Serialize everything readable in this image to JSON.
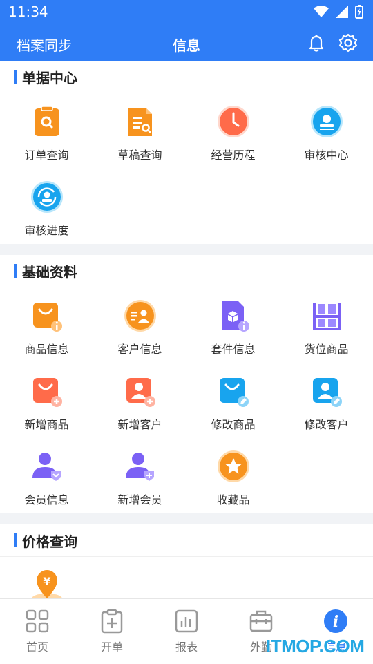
{
  "status_bar": {
    "time": "11:34"
  },
  "header": {
    "left_label": "档案同步",
    "title": "信息"
  },
  "sections": [
    {
      "title": "单据中心",
      "items": [
        {
          "label": "订单查询",
          "icon": "order-search-icon"
        },
        {
          "label": "草稿查询",
          "icon": "draft-search-icon"
        },
        {
          "label": "经营历程",
          "icon": "clock-icon"
        },
        {
          "label": "审核中心",
          "icon": "review-center-icon"
        },
        {
          "label": "审核进度",
          "icon": "review-progress-icon"
        }
      ]
    },
    {
      "title": "基础资料",
      "items": [
        {
          "label": "商品信息",
          "icon": "product-info-icon"
        },
        {
          "label": "客户信息",
          "icon": "customer-info-icon"
        },
        {
          "label": "套件信息",
          "icon": "kit-info-icon"
        },
        {
          "label": "货位商品",
          "icon": "shelf-icon"
        },
        {
          "label": "新增商品",
          "icon": "add-product-icon"
        },
        {
          "label": "新增客户",
          "icon": "add-customer-icon"
        },
        {
          "label": "修改商品",
          "icon": "edit-product-icon"
        },
        {
          "label": "修改客户",
          "icon": "edit-customer-icon"
        },
        {
          "label": "会员信息",
          "icon": "member-info-icon"
        },
        {
          "label": "新增会员",
          "icon": "add-member-icon"
        },
        {
          "label": "收藏品",
          "icon": "star-icon"
        }
      ]
    },
    {
      "title": "价格查询",
      "items": [
        {
          "label": "",
          "icon": "price-location-icon"
        }
      ]
    }
  ],
  "bottom_nav": [
    {
      "label": "首页",
      "icon": "grid-icon",
      "active": false
    },
    {
      "label": "开单",
      "icon": "new-order-icon",
      "active": false
    },
    {
      "label": "报表",
      "icon": "report-icon",
      "active": false
    },
    {
      "label": "外勤",
      "icon": "briefcase-icon",
      "active": false
    },
    {
      "label": "信息",
      "icon": "info-icon",
      "active": true
    }
  ],
  "watermark": "ITMOP.COM",
  "colors": {
    "primary": "#2f7df6",
    "orange": "#f7931e",
    "red": "#ff6b4a",
    "purple": "#7b61f5",
    "cyan": "#18a4ee"
  }
}
